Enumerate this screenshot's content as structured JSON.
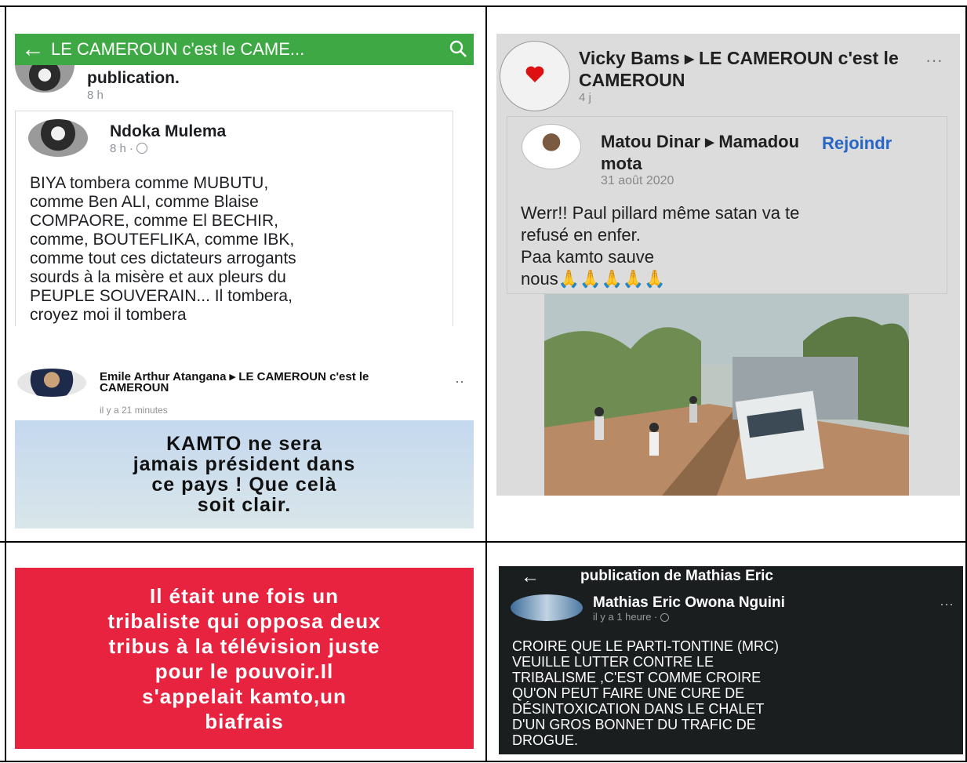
{
  "panel1": {
    "app_bar": {
      "title": "LE CAMEROUN c'est le CAME..."
    },
    "prev_post": {
      "text": "publication.",
      "time": "8 h"
    },
    "card": {
      "author": "Ndoka Mulema",
      "time": "8 h · ",
      "text": "BIYA tombera comme MUBUTU,\ncomme Ben ALI, comme Blaise\nCOMPAORE, comme El BECHIR,\ncomme, BOUTEFLIKA, comme IBK,\ncomme tout ces dictateurs arrogants\nsourds à la misère et aux pleurs du\nPEUPLE SOUVERAIN... Il tombera,\ncroyez moi il tombera"
    },
    "second_post": {
      "author_line": "Emile Arthur Atangana ▸ LE CAMEROUN c'est le CAMEROUN",
      "time": "il y a 21 minutes",
      "image_text": "KAMTO ne sera\njamais président dans\nce pays ! Que celà\nsoit clair."
    }
  },
  "panel2": {
    "author_line": "Vicky Bams ▸ LE CAMEROUN c'est le CAMEROUN",
    "time": "4 j",
    "shared": {
      "author_line": "Matou Dinar ▸ Mamadou mota",
      "join_label": "Rejoindr",
      "time": "31 août 2020",
      "text": "Werr!! Paul pillard même satan va te\nrefusé en enfer.\n      Paa kamto sauve\nnous🙏🙏🙏🙏🙏"
    }
  },
  "panel3": {
    "image_text": "Il était une fois un\ntribaliste qui opposa deux\ntribus à la télévision juste\npour le pouvoir.Il\ns'appelait kamto,un\nbiafrais"
  },
  "panel4": {
    "header": "publication de Mathias Eric",
    "author": "Mathias Eric Owona Nguini",
    "time": "il y a 1 heure · ",
    "text": "CROIRE QUE LE PARTI-TONTINE (MRC)\nVEUILLE LUTTER CONTRE LE\nTRIBALISME ,C'EST COMME CROIRE\nQU'ON PEUT FAIRE UNE CURE DE\nDÉSINTOXICATION DANS LE CHALET\nD'UN GROS BONNET DU TRAFIC DE\nDROGUE."
  },
  "colors": {
    "app_bar_green": "#3ea944",
    "link_blue": "#2766c5",
    "banner_red": "#e8233f",
    "dark_bg": "#1a1e1f"
  }
}
